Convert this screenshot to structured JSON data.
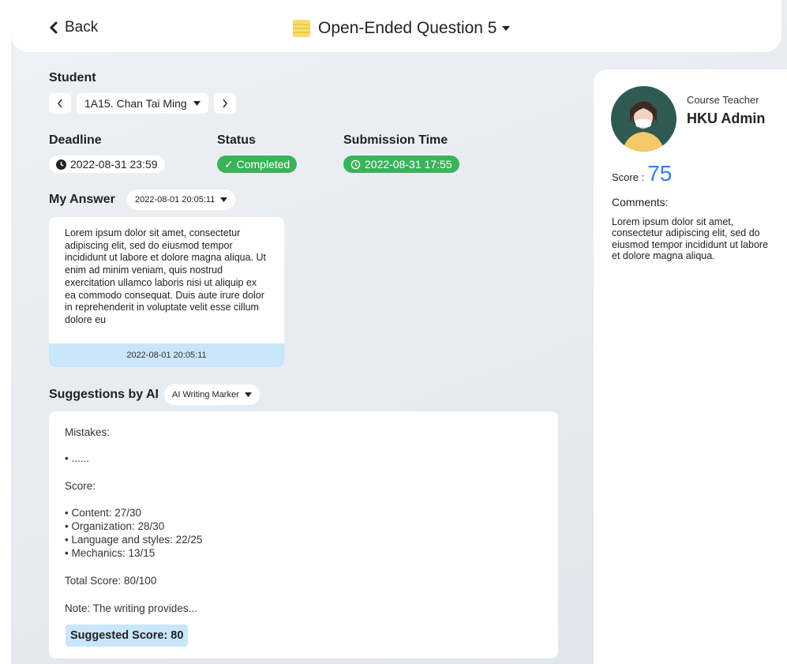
{
  "header": {
    "back_label": "Back",
    "title": "Open-Ended Question 5"
  },
  "student": {
    "label": "Student",
    "selected": "1A15. Chan Tai Ming"
  },
  "deadline": {
    "label": "Deadline",
    "value": "2022-08-31 23:59"
  },
  "status": {
    "label": "Status",
    "value": "✓ Completed"
  },
  "submission": {
    "label": "Submission Time",
    "value": "2022-08-31 17:55"
  },
  "my_answer": {
    "label": "My Answer",
    "version": "2022-08-01 20:05:11",
    "text": "Lorem ipsum dolor sit amet, consectetur adipiscing elit, sed do eiusmod tempor incididunt ut labore et dolore magna aliqua. Ut enim ad minim veniam, quis nostrud exercitation ullamco laboris nisi ut aliquip ex ea commodo consequat. Duis aute irure dolor in reprehenderit in voluptate velit esse cillum dolore eu",
    "timestamp": "2022-08-01 20:05:11"
  },
  "ai": {
    "label": "Suggestions by AI",
    "marker": "AI Writing Marker",
    "mistakes_label": "Mistakes:",
    "mistakes_item": "......",
    "score_label": "Score:",
    "items": [
      "Content: 27/30",
      "Organization: 28/30",
      "Language and styles: 22/25",
      "Mechanics: 13/15"
    ],
    "total": "Total Score: 80/100",
    "note": "Note: The writing provides...",
    "suggested": "Suggested Score: 80"
  },
  "teacher": {
    "role": "Course Teacher",
    "name": "HKU Admin",
    "score_label": "Score :",
    "score": "75",
    "comments_label": "Comments:",
    "comments": "Lorem ipsum dolor sit amet, consectetur adipiscing elit, sed do eiusmod tempor incididunt ut labore et dolore magna aliqua."
  },
  "colors": {
    "accent_blue": "#2f80ed",
    "status_green": "#3bb35a",
    "highlight_blue": "#c9e6fb"
  }
}
